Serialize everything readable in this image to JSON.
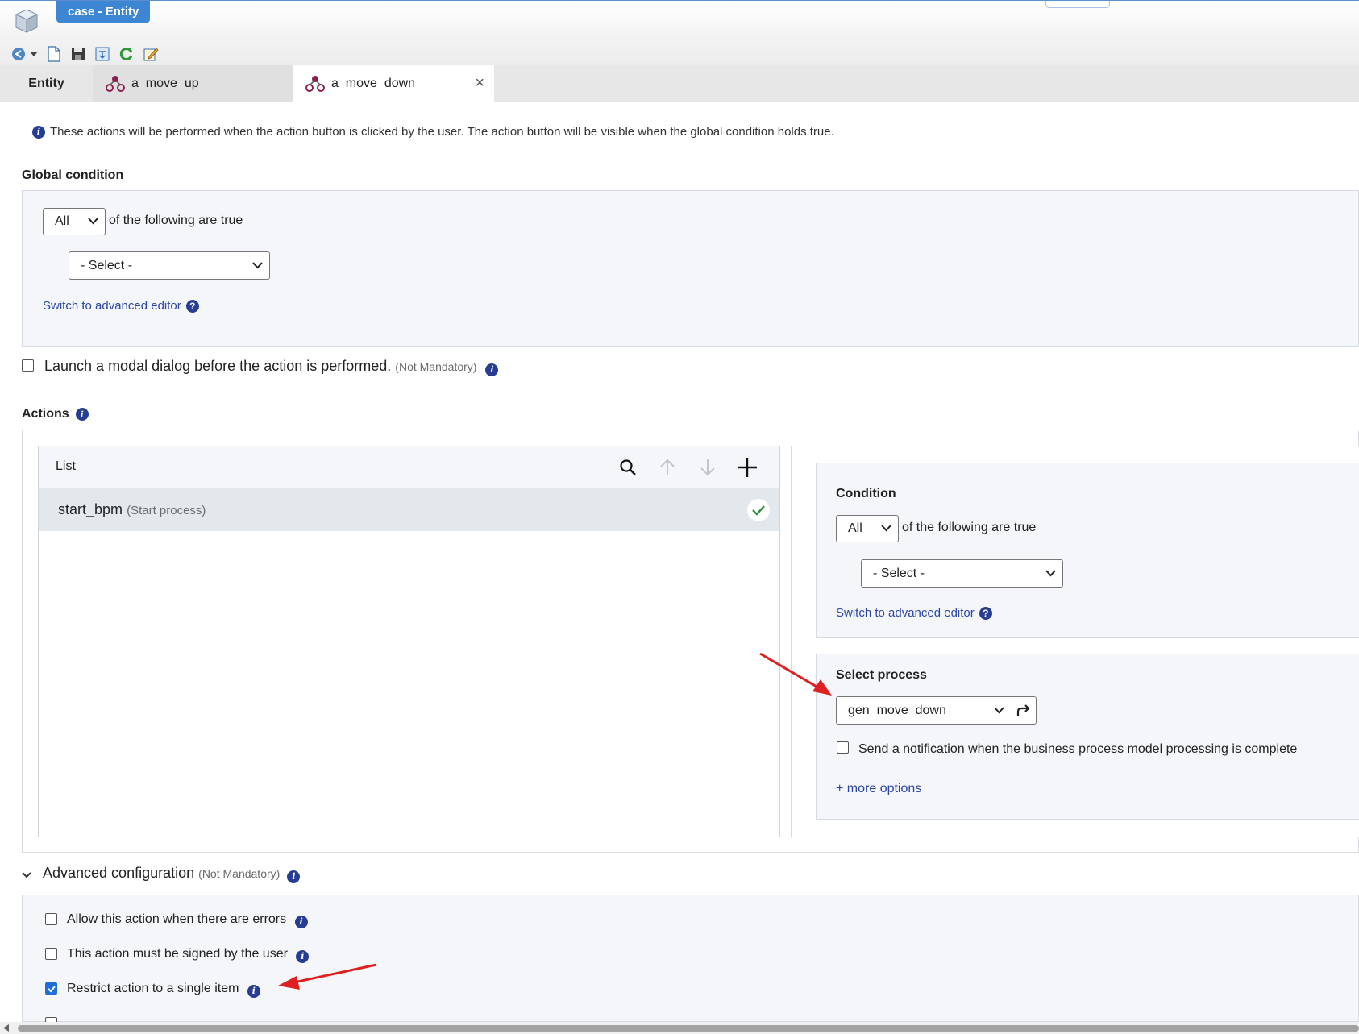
{
  "window": {
    "title": "case - Entity"
  },
  "tabs": [
    {
      "label": "Entity"
    },
    {
      "label": "a_move_up"
    },
    {
      "label": "a_move_down",
      "close": "×"
    }
  ],
  "info_text": "These actions will be performed when the action button is clicked by the user. The action button will be visible when the global condition holds true.",
  "global_condition": {
    "title": "Global condition",
    "quantifier": "All",
    "quantifier_suffix": "of the following are true",
    "field_select": "- Select -",
    "advanced_link": "Switch to advanced editor"
  },
  "modal_option": {
    "label": "Launch a modal dialog before the action is performed.",
    "note": "(Not Mandatory)",
    "checked": false
  },
  "actions": {
    "title": "Actions",
    "list_header": "List",
    "items": [
      {
        "name": "start_bpm",
        "type": "(Start process)"
      }
    ]
  },
  "condition": {
    "title": "Condition",
    "quantifier": "All",
    "quantifier_suffix": "of the following are true",
    "field_select": "- Select -",
    "advanced_link": "Switch to advanced editor"
  },
  "select_process": {
    "title": "Select process",
    "value": "gen_move_down",
    "notify_label": "Send a notification when the business process model processing is complete",
    "notify_checked": false,
    "more_options": "+ more options"
  },
  "advanced_config": {
    "title": "Advanced configuration",
    "note": "(Not Mandatory)",
    "options": [
      {
        "label": "Allow this action when there are errors",
        "checked": false
      },
      {
        "label": "This action must be signed by the user",
        "checked": false
      },
      {
        "label": "Restrict action to a single item",
        "checked": true
      }
    ]
  },
  "colors": {
    "title_tab": "#3d86d4",
    "link": "#2b46a6",
    "info_icon": "#273d93",
    "annotation_arrow": "#e02020",
    "checkbox_checked": "#1e6fd9"
  }
}
